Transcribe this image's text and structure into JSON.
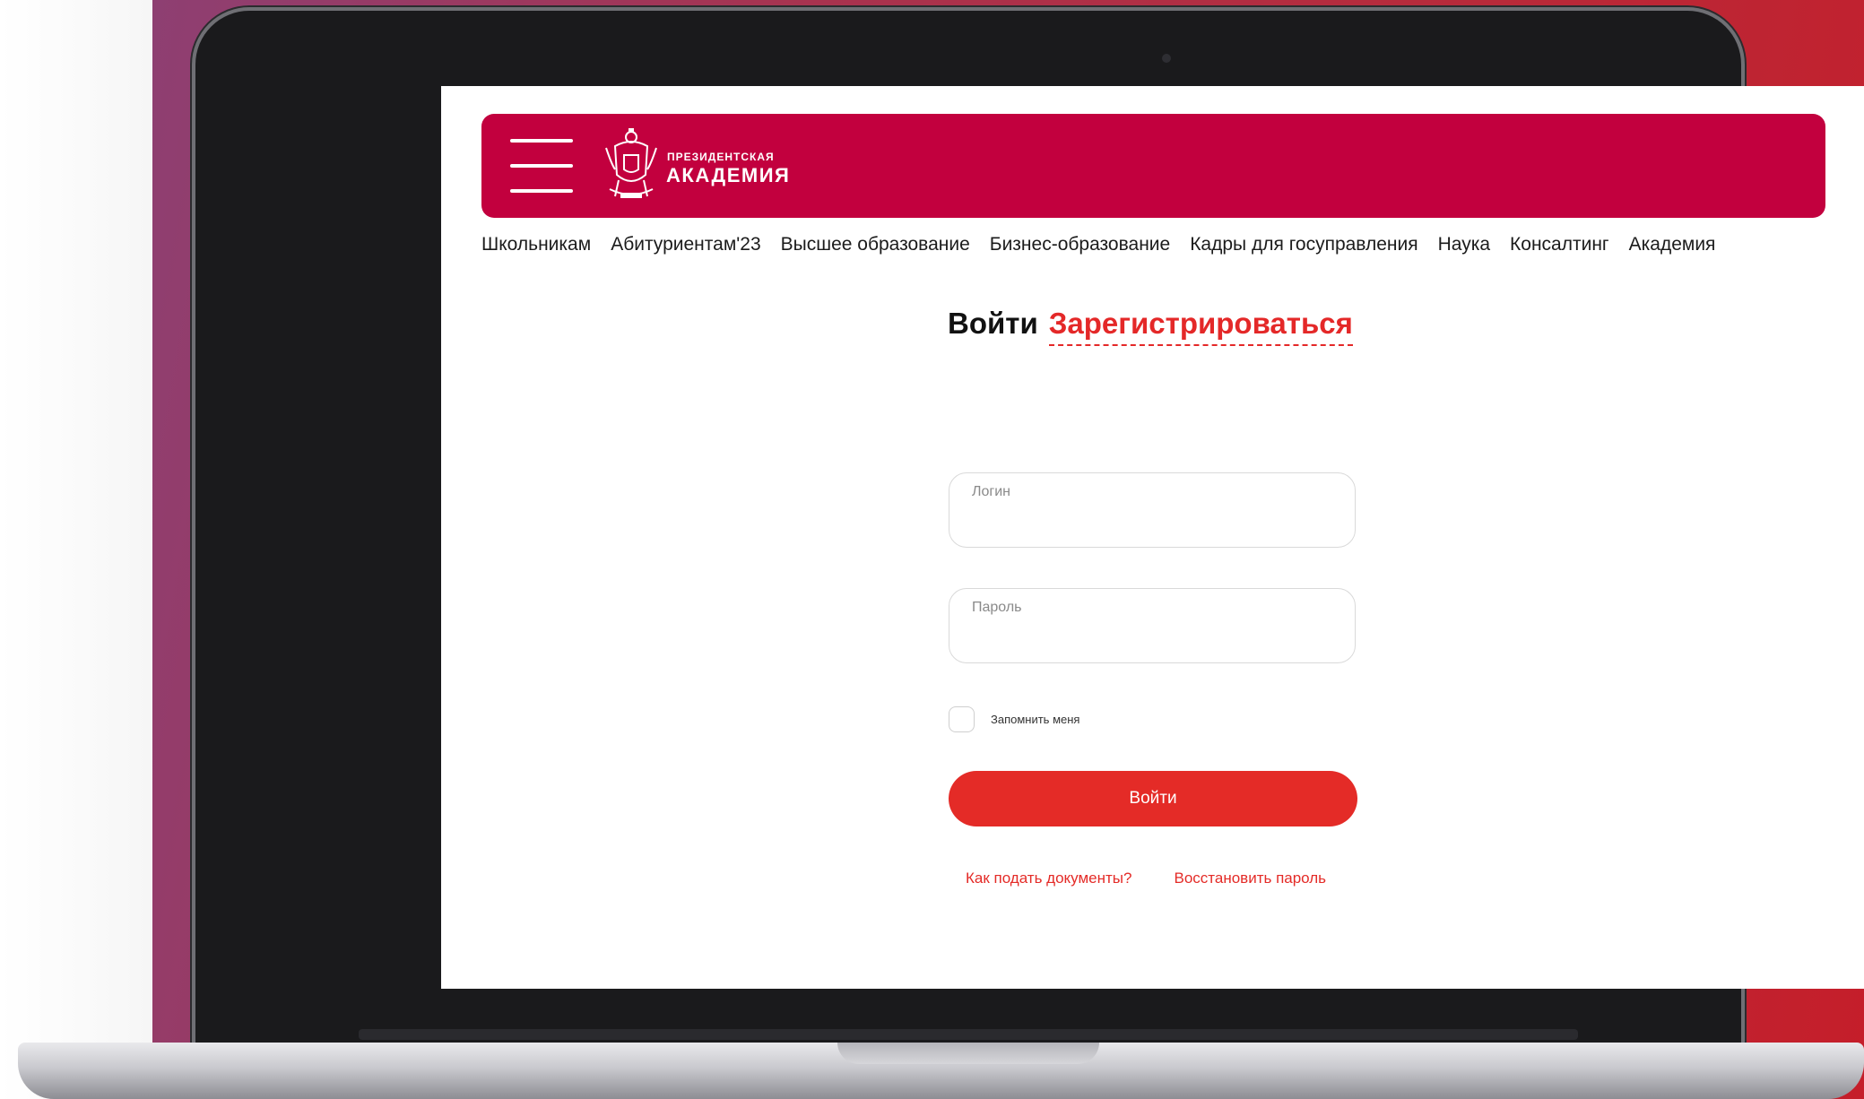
{
  "header": {
    "logo_small": "ПРЕЗИДЕНТСКАЯ",
    "logo_big": "АКАДЕМИЯ",
    "brand_color": "#c2003e"
  },
  "nav": {
    "items": [
      "Школьникам",
      "Абитуриентам'23",
      "Высшее образование",
      "Бизнес-образование",
      "Кадры для госуправления",
      "Наука",
      "Консалтинг",
      "Академия"
    ]
  },
  "auth": {
    "login_tab": "Войти",
    "register_tab": "Зарегистрироваться",
    "accent_color": "#e42b27"
  },
  "form": {
    "login_label": "Логин",
    "login_value": "",
    "password_label": "Пароль",
    "password_value": "",
    "remember_label": "Запомнить меня",
    "submit_label": "Войти"
  },
  "links": {
    "how_to_submit": "Как подать документы?",
    "restore_password": "Восстановить пароль"
  }
}
